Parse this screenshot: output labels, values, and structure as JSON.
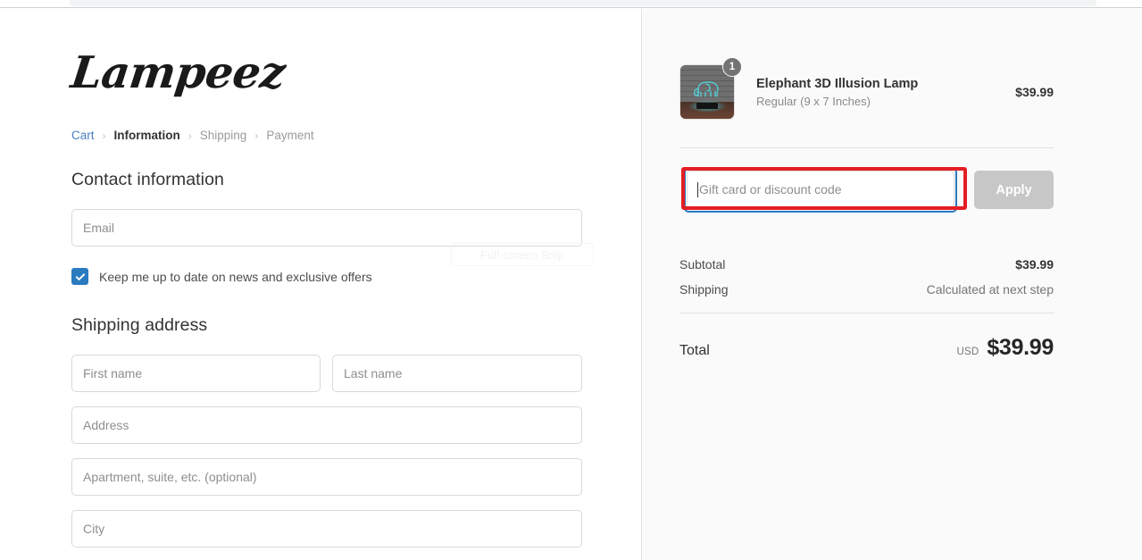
{
  "brand": {
    "logo_text": "Lampeez"
  },
  "breadcrumb": {
    "separator": "›",
    "items": [
      {
        "label": "Cart",
        "state": "link"
      },
      {
        "label": "Information",
        "state": "current"
      },
      {
        "label": "Shipping",
        "state": "upcoming"
      },
      {
        "label": "Payment",
        "state": "upcoming"
      }
    ]
  },
  "contact": {
    "heading": "Contact information",
    "email_placeholder": "Email",
    "email_value": "",
    "newsletter_label": "Keep me up to date on news and exclusive offers",
    "newsletter_checked": true,
    "check_icon": "check-icon"
  },
  "shipping_address": {
    "heading": "Shipping address",
    "fields": [
      {
        "name": "first-name",
        "placeholder": "First name",
        "value": ""
      },
      {
        "name": "last-name",
        "placeholder": "Last name",
        "value": ""
      },
      {
        "name": "address",
        "placeholder": "Address",
        "value": ""
      },
      {
        "name": "apartment",
        "placeholder": "Apartment, suite, etc. (optional)",
        "value": ""
      },
      {
        "name": "city",
        "placeholder": "City",
        "value": ""
      }
    ]
  },
  "order_summary": {
    "line_item": {
      "title": "Elephant 3D Illusion Lamp",
      "variant": "Regular (9 x 7 Inches)",
      "price": "$39.99",
      "quantity": "1",
      "image_alt": "elephant-3d-illusion-lamp-thumbnail"
    },
    "discount": {
      "placeholder": "Gift card or discount code",
      "value": "",
      "apply_label": "Apply",
      "apply_disabled": true,
      "focused": true
    },
    "totals": [
      {
        "label": "Subtotal",
        "value": "$39.99",
        "muted": false
      },
      {
        "label": "Shipping",
        "value": "Calculated at next step",
        "muted": true
      }
    ],
    "grand_total": {
      "label": "Total",
      "currency": "USD",
      "amount": "$39.99"
    }
  },
  "overlay": {
    "snip_watermark": "Full-screen Snip"
  },
  "colors": {
    "accent_blue": "#2a7ac0",
    "link_blue": "#4a7fc1",
    "annotation_red": "#e31e24",
    "summary_bg": "#fafafa",
    "apply_disabled": "#c7c7c7",
    "lamp_cyan": "#3cdceb"
  }
}
